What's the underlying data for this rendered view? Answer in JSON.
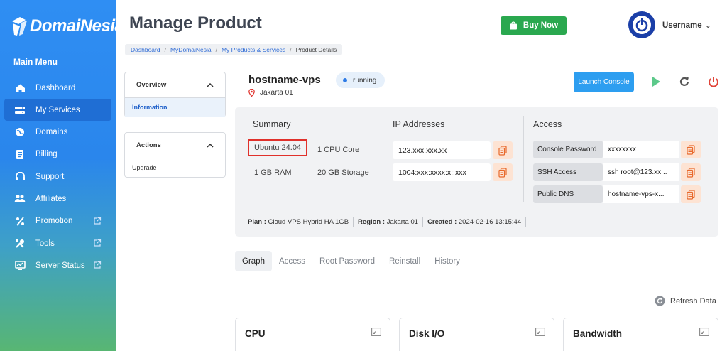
{
  "brand": {
    "name": "DomaiNesia"
  },
  "sidebar": {
    "menu_title": "Main Menu",
    "items": [
      {
        "label": "Dashboard",
        "icon": "dashboard-icon",
        "active": false,
        "external": false
      },
      {
        "label": "My Services",
        "icon": "services-icon",
        "active": true,
        "external": false
      },
      {
        "label": "Domains",
        "icon": "globe-icon",
        "active": false,
        "external": false
      },
      {
        "label": "Billing",
        "icon": "billing-icon",
        "active": false,
        "external": false
      },
      {
        "label": "Support",
        "icon": "support-icon",
        "active": false,
        "external": false
      },
      {
        "label": "Affiliates",
        "icon": "affiliates-icon",
        "active": false,
        "external": false
      },
      {
        "label": "Promotion",
        "icon": "percent-icon",
        "active": false,
        "external": true
      },
      {
        "label": "Tools",
        "icon": "tools-icon",
        "active": false,
        "external": true
      },
      {
        "label": "Server Status",
        "icon": "monitor-icon",
        "active": false,
        "external": true
      }
    ]
  },
  "header": {
    "title": "Manage Product",
    "buy_now": "Buy Now",
    "username": "Username"
  },
  "breadcrumb": [
    "Dashboard",
    "MyDomaiNesia",
    "My Products & Services",
    "Product Details"
  ],
  "left_panels": {
    "overview": {
      "title": "Overview",
      "items": [
        "Information"
      ]
    },
    "actions": {
      "title": "Actions",
      "items": [
        "Upgrade"
      ]
    }
  },
  "product": {
    "hostname": "hostname-vps",
    "status": "running",
    "location": "Jakarta 01",
    "launch_console": "Launch Console"
  },
  "summary": {
    "title": "Summary",
    "os": "Ubuntu 24.04",
    "cpu": "1 CPU Core",
    "ram": "1 GB RAM",
    "storage": "20 GB Storage"
  },
  "ip_addresses": {
    "title": "IP Addresses",
    "ipv4": "123.xxx.xxx.xx",
    "ipv6": "1004:xxx:xxxx:x::xxx"
  },
  "access": {
    "title": "Access",
    "rows": [
      {
        "label": "Console Password",
        "value": "xxxxxxxx"
      },
      {
        "label": "SSH Access",
        "value": "ssh root@123.xx..."
      },
      {
        "label": "Public DNS",
        "value": "hostname-vps-x..."
      }
    ]
  },
  "plan_info": {
    "plan_label": "Plan :",
    "plan": "Cloud VPS Hybrid HA 1GB",
    "region_label": "Region :",
    "region": "Jakarta 01",
    "created_label": "Created :",
    "created": "2024-02-16 13:15:44"
  },
  "tabs": [
    "Graph",
    "Access",
    "Root Password",
    "Reinstall",
    "History"
  ],
  "refresh_label": "Refresh Data",
  "cards": [
    "CPU",
    "Disk I/O",
    "Bandwidth"
  ],
  "colors": {
    "primary": "#2d9ef0",
    "buy": "#2aa84f",
    "highlight": "#e0312b",
    "copy": "#e8692c"
  }
}
